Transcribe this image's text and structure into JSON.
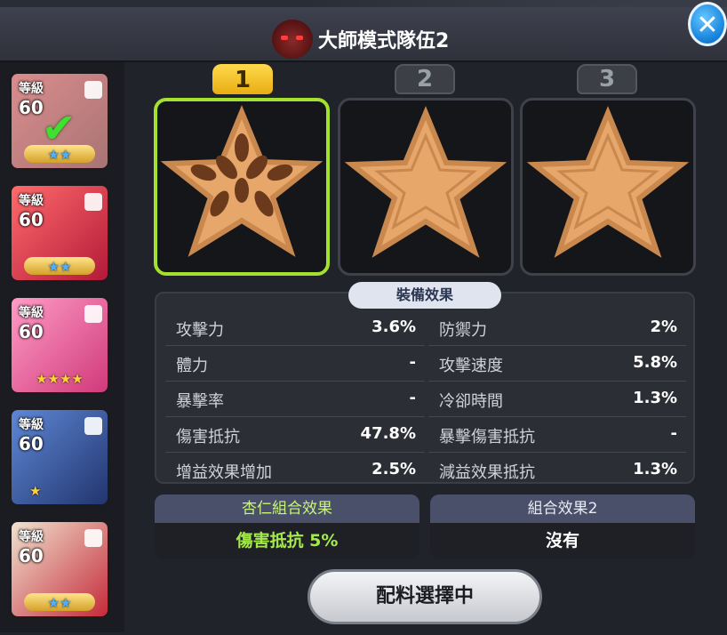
{
  "header": {
    "title": "大師模式隊伍2"
  },
  "sidebar": {
    "cards": [
      {
        "level_label": "等級",
        "level": "60",
        "stars": "★★",
        "star_color": "blue",
        "selected": true,
        "bg": "#c04a4a"
      },
      {
        "level_label": "等級",
        "level": "60",
        "stars": "★★",
        "star_color": "blue",
        "selected": false,
        "bg": "#d9304a"
      },
      {
        "level_label": "等級",
        "level": "60",
        "stars": "★★★★",
        "star_color": "gold",
        "selected": false,
        "bg": "#e26aa0"
      },
      {
        "level_label": "等級",
        "level": "60",
        "stars": "★",
        "star_color": "gold",
        "selected": false,
        "bg": "#4a66a8"
      },
      {
        "level_label": "等級",
        "level": "60",
        "stars": "★★",
        "star_color": "blue",
        "selected": false,
        "bg": "#d23040"
      }
    ]
  },
  "slots": {
    "tabs": [
      {
        "label": "1",
        "active": true
      },
      {
        "label": "2",
        "active": false
      },
      {
        "label": "3",
        "active": false
      }
    ],
    "slot_items": [
      {
        "equipped": true,
        "item": "almond-star-topping"
      },
      {
        "equipped": false,
        "item": "empty-star-slot"
      },
      {
        "equipped": false,
        "item": "empty-star-slot"
      }
    ]
  },
  "effects": {
    "header": "裝備效果",
    "left": [
      {
        "name": "攻擊力",
        "value": "3.6%"
      },
      {
        "name": "體力",
        "value": "-"
      },
      {
        "name": "暴擊率",
        "value": "-"
      },
      {
        "name": "傷害抵抗",
        "value": "47.8%"
      },
      {
        "name": "增益效果增加",
        "value": "2.5%"
      }
    ],
    "right": [
      {
        "name": "防禦力",
        "value": "2%"
      },
      {
        "name": "攻擊速度",
        "value": "5.8%"
      },
      {
        "name": "冷卻時間",
        "value": "1.3%"
      },
      {
        "name": "暴擊傷害抵抗",
        "value": "-"
      },
      {
        "name": "減益效果抵抗",
        "value": "1.3%"
      }
    ]
  },
  "combo": {
    "first": {
      "title": "杏仁組合效果",
      "value": "傷害抵抗 5%"
    },
    "second": {
      "title": "組合效果2",
      "value": "沒有"
    }
  },
  "action": {
    "button_label": "配料選擇中"
  },
  "colors": {
    "accent_green": "#a4e02e",
    "active_tab": "#ffd94d",
    "close_blue": "#1d8ae0"
  }
}
